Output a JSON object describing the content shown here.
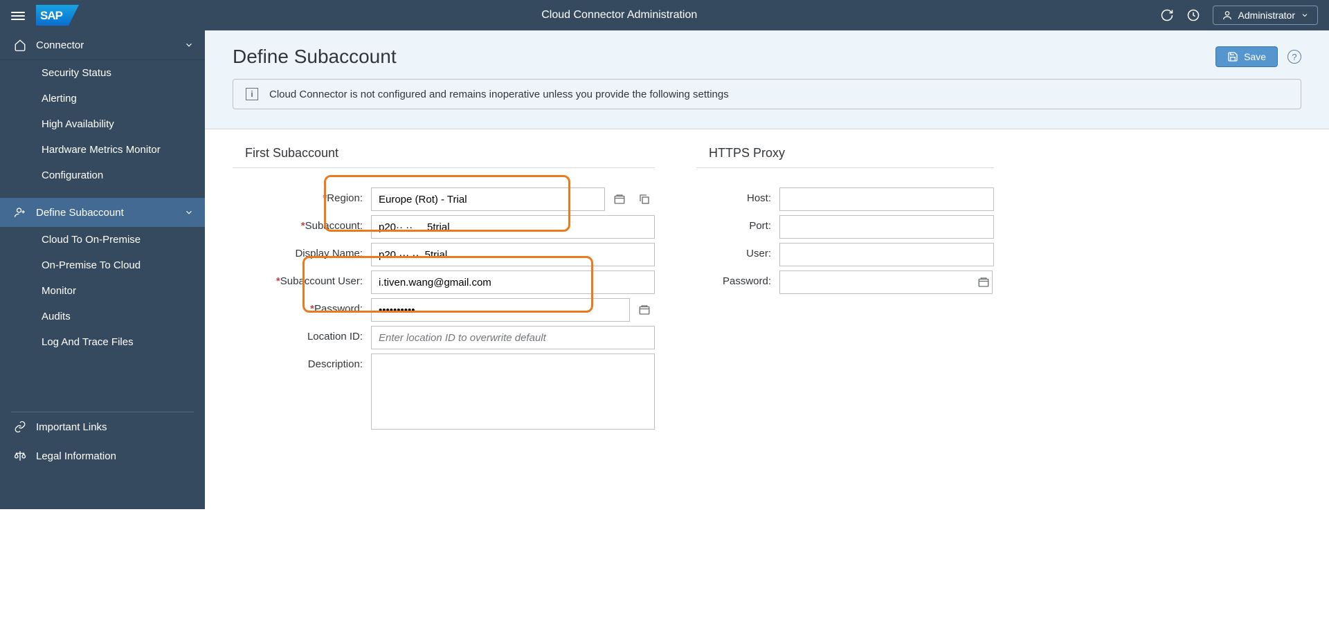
{
  "header": {
    "logo": "SAP",
    "title": "Cloud Connector Administration",
    "user_label": "Administrator"
  },
  "sidebar": {
    "connector": {
      "label": "Connector",
      "items": [
        "Security Status",
        "Alerting",
        "High Availability",
        "Hardware Metrics Monitor",
        "Configuration"
      ]
    },
    "subaccount": {
      "label": "Define Subaccount",
      "items": [
        "Cloud To On-Premise",
        "On-Premise To Cloud",
        "Monitor",
        "Audits",
        "Log And Trace Files"
      ]
    },
    "footer": {
      "important_links": "Important Links",
      "legal": "Legal Information"
    }
  },
  "page": {
    "title": "Define Subaccount",
    "save": "Save",
    "info": "Cloud Connector is not configured and remains inoperative unless you provide the following settings"
  },
  "subaccount_form": {
    "heading": "First Subaccount",
    "region": {
      "label": "Region:",
      "value": "Europe (Rot) - Trial"
    },
    "subaccount": {
      "label": "Subaccount:",
      "value": "p20·· ··     5trial"
    },
    "display_name": {
      "label": "Display Name:",
      "value": "p20 ··· ··  5trial"
    },
    "user": {
      "label": "Subaccount User:",
      "value": "i.tiven.wang@gmail.com"
    },
    "password": {
      "label": "Password:",
      "value": "••••••••••"
    },
    "location": {
      "label": "Location ID:",
      "placeholder": "Enter location ID to overwrite default"
    },
    "description": {
      "label": "Description:"
    }
  },
  "proxy_form": {
    "heading": "HTTPS Proxy",
    "host": {
      "label": "Host:"
    },
    "port": {
      "label": "Port:"
    },
    "user": {
      "label": "User:"
    },
    "password": {
      "label": "Password:"
    }
  }
}
